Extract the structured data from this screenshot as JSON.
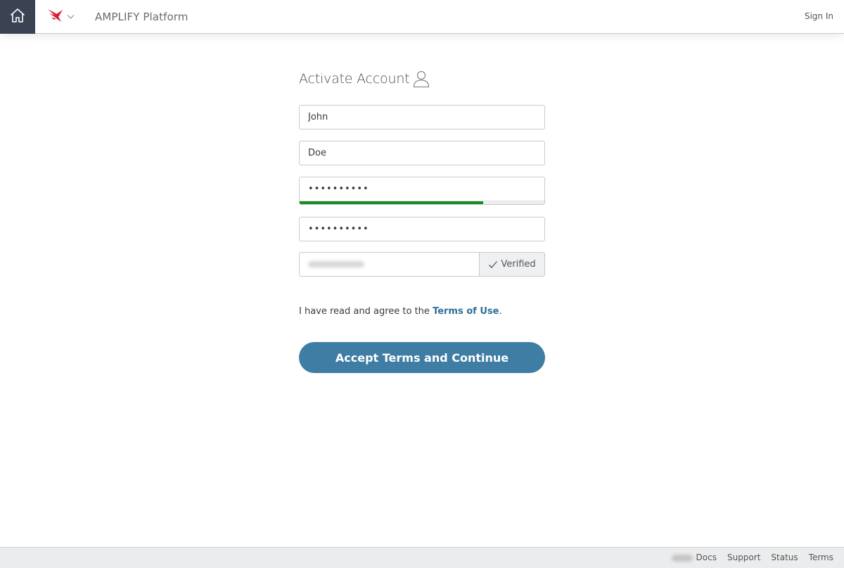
{
  "header": {
    "app_title": "AMPLIFY Platform",
    "sign_in_label": "Sign In",
    "icons": {
      "home": "home-icon",
      "logo": "axway-logo-icon",
      "switcher": "chevron-down-icon"
    },
    "colors": {
      "home_bg": "#3b4251",
      "logo": "#d7172f"
    }
  },
  "form": {
    "title": "Activate Account",
    "title_icon": "user-icon",
    "first_name": "John",
    "last_name": "Doe",
    "password": "••••••••••",
    "password_strength": 0.75,
    "confirm_password": "••••••••••",
    "email_value": "",
    "email_status": "Verified",
    "email_status_icon": "check-icon",
    "terms_text": "I have read and agree to the",
    "terms_link": "Terms of Use",
    "terms_suffix": ".",
    "submit_label": "Accept Terms and Continue",
    "colors": {
      "accent": "#3f7da5",
      "link": "#2e6e99",
      "strength": "#1d8a1d"
    }
  },
  "footer": {
    "links": [
      "Docs",
      "Support",
      "Status",
      "Terms"
    ]
  }
}
